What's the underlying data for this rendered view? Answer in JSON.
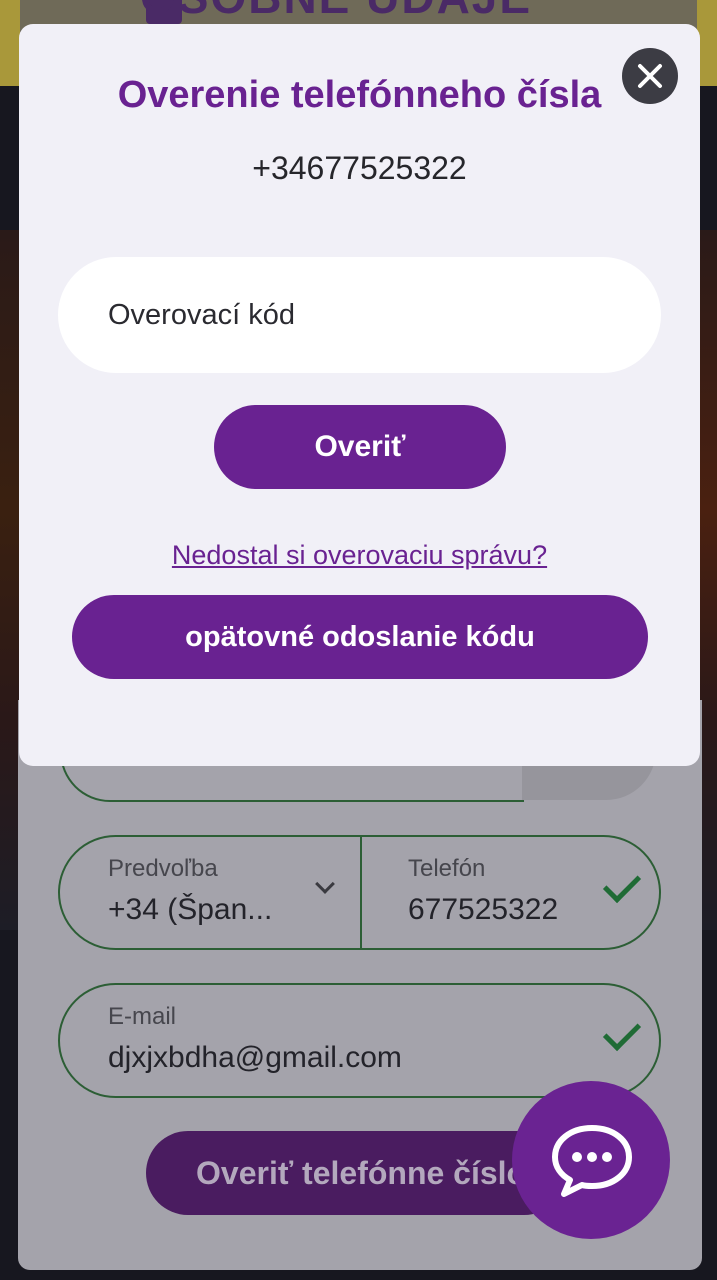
{
  "background": {
    "heading": "OSOBNÉ ÚDAJE",
    "prefix_field": {
      "label": "Predvoľba",
      "value": "+34 (Špan..."
    },
    "phone_field": {
      "label": "Telefón",
      "value": "677525322"
    },
    "email_field": {
      "label": "E-mail",
      "value": "djxjxbdha@gmail.com"
    },
    "verify_phone_button": "Overiť telefónne číslo"
  },
  "modal": {
    "title": "Overenie telefónneho čísla",
    "phone_number": "+34677525322",
    "code_placeholder": "Overovací kód",
    "verify_button": "Overiť",
    "no_message_link": "Nedostal si overovaciu správu?",
    "resend_button": "opätovné odoslanie kódu"
  },
  "icons": {
    "close": "close-icon",
    "chevron": "chevron-down-icon",
    "check": "check-icon",
    "chat": "chat-bubble-icon"
  },
  "colors": {
    "accent": "#692291",
    "valid": "#1f6b35"
  }
}
